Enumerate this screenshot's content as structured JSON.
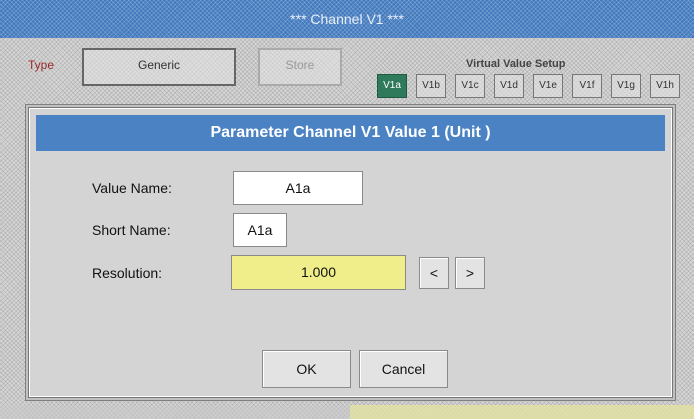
{
  "window": {
    "title": "*** Channel V1 ***"
  },
  "background": {
    "type_label": "Type",
    "type_value": "Generic",
    "store_button": "Store",
    "virtual_setup_title": "Virtual Value Setup",
    "virtual_tabs": [
      "V1a",
      "V1b",
      "V1c",
      "V1d",
      "V1e",
      "V1f",
      "V1g",
      "V1h"
    ],
    "active_tab": "V1a"
  },
  "dialog": {
    "title": "Parameter Channel V1 Value 1 (Unit  )",
    "value_name_label": "Value Name:",
    "value_name": "A1a",
    "short_name_label": "Short Name:",
    "short_name": "A1a",
    "resolution_label": "Resolution:",
    "resolution": "1.000",
    "decrease_label": "<",
    "increase_label": ">",
    "ok_label": "OK",
    "cancel_label": "Cancel"
  },
  "colors": {
    "title_bar": "#3f78bd",
    "dialog_header": "#4a82c4",
    "resolution_field": "#f0ee8a",
    "active_tab": "#2f7a5a"
  }
}
